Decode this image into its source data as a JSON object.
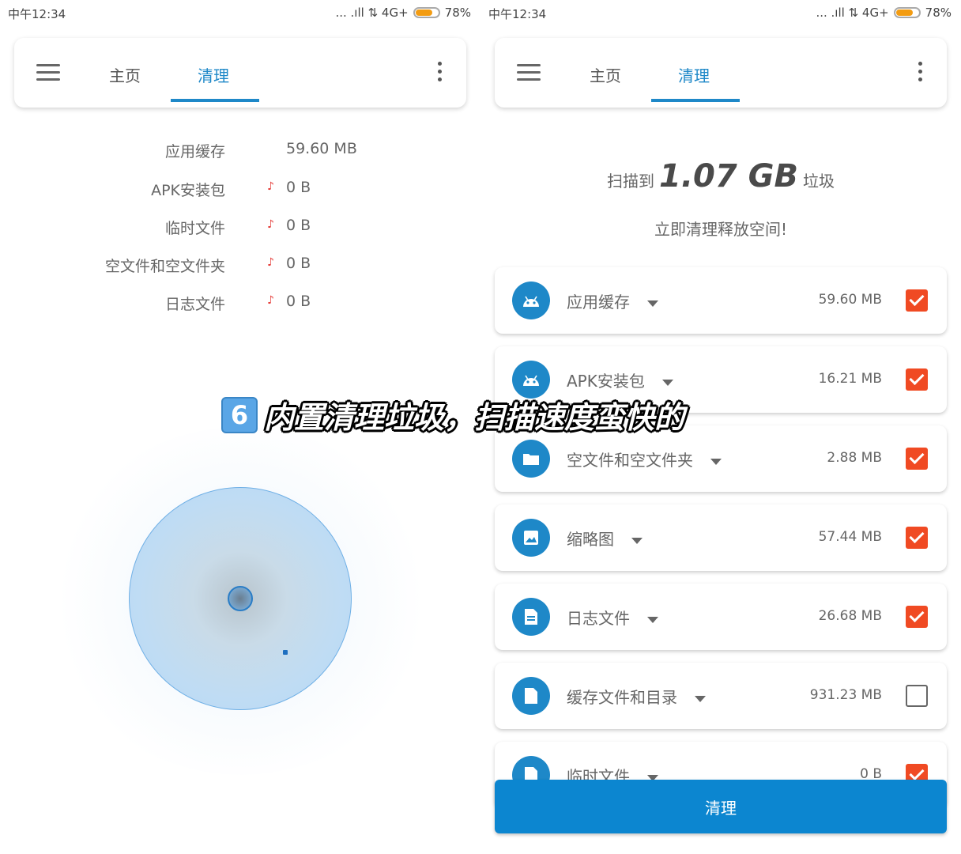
{
  "status_bar": {
    "time": "中午12:34",
    "signal": "... .ıll ⇅ 4G+",
    "battery": "78%"
  },
  "appbar": {
    "tab_home": "主页",
    "tab_clean": "清理"
  },
  "scan_progress": {
    "rows": [
      {
        "label": "应用缓存",
        "value": "59.60 MB",
        "tick": ""
      },
      {
        "label": "APK安装包",
        "value": "0 B",
        "tick": "♪"
      },
      {
        "label": "临时文件",
        "value": "0 B",
        "tick": "♪"
      },
      {
        "label": "空文件和空文件夹",
        "value": "0 B",
        "tick": "♪"
      },
      {
        "label": "日志文件",
        "value": "0 B",
        "tick": "♪"
      }
    ]
  },
  "summary": {
    "prefix": "扫描到",
    "size": "1.07 GB",
    "suffix": "垃圾",
    "subtitle": "立即清理释放空间!"
  },
  "junk_items": [
    {
      "name": "应用缓存",
      "size": "59.60 MB",
      "checked": true,
      "icon": "android-icon"
    },
    {
      "name": "APK安装包",
      "size": "16.21 MB",
      "checked": true,
      "icon": "android-icon"
    },
    {
      "name": "空文件和空文件夹",
      "size": "2.88 MB",
      "checked": true,
      "icon": "folder-icon"
    },
    {
      "name": "缩略图",
      "size": "57.44 MB",
      "checked": true,
      "icon": "image-icon"
    },
    {
      "name": "日志文件",
      "size": "26.68 MB",
      "checked": true,
      "icon": "document-icon"
    },
    {
      "name": "缓存文件和目录",
      "size": "931.23 MB",
      "checked": false,
      "icon": "file-icon"
    },
    {
      "name": "临时文件",
      "size": "0 B",
      "checked": true,
      "icon": "file-icon"
    }
  ],
  "clean_button": "清理",
  "caption": {
    "number": "6",
    "text": "内置清理垃圾，扫描速度蛮快的"
  },
  "colors": {
    "accent": "#1e88c8",
    "check": "#f04a23",
    "button": "#0c86d0"
  }
}
